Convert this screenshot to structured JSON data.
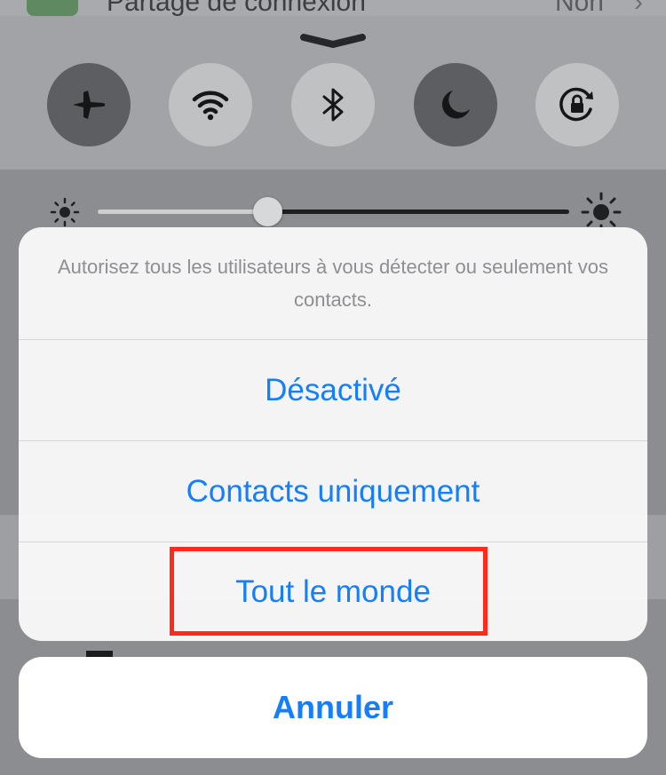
{
  "background": {
    "settings_row": {
      "label": "Partage de connexion",
      "value": "Non",
      "chevron": "›"
    },
    "control_center": {
      "toggles": [
        {
          "id": "airplane",
          "icon": "airplane-icon",
          "active": true
        },
        {
          "id": "wifi",
          "icon": "wifi-icon",
          "active": false
        },
        {
          "id": "bluetooth",
          "icon": "bluetooth-icon",
          "active": false
        },
        {
          "id": "do-not-disturb",
          "icon": "moon-icon",
          "active": true
        },
        {
          "id": "rotation-lock",
          "icon": "rotation-lock-icon",
          "active": false
        }
      ],
      "brightness": {
        "level": 0.36
      }
    }
  },
  "action_sheet": {
    "message": "Autorisez tous les utilisateurs à vous détecter ou seulement vos contacts.",
    "options": [
      {
        "label": "Désactivé"
      },
      {
        "label": "Contacts uniquement"
      },
      {
        "label": "Tout le monde",
        "highlighted": true
      }
    ],
    "cancel_label": "Annuler"
  },
  "colors": {
    "accent": "#147efb",
    "highlight": "#ff2a1a"
  }
}
